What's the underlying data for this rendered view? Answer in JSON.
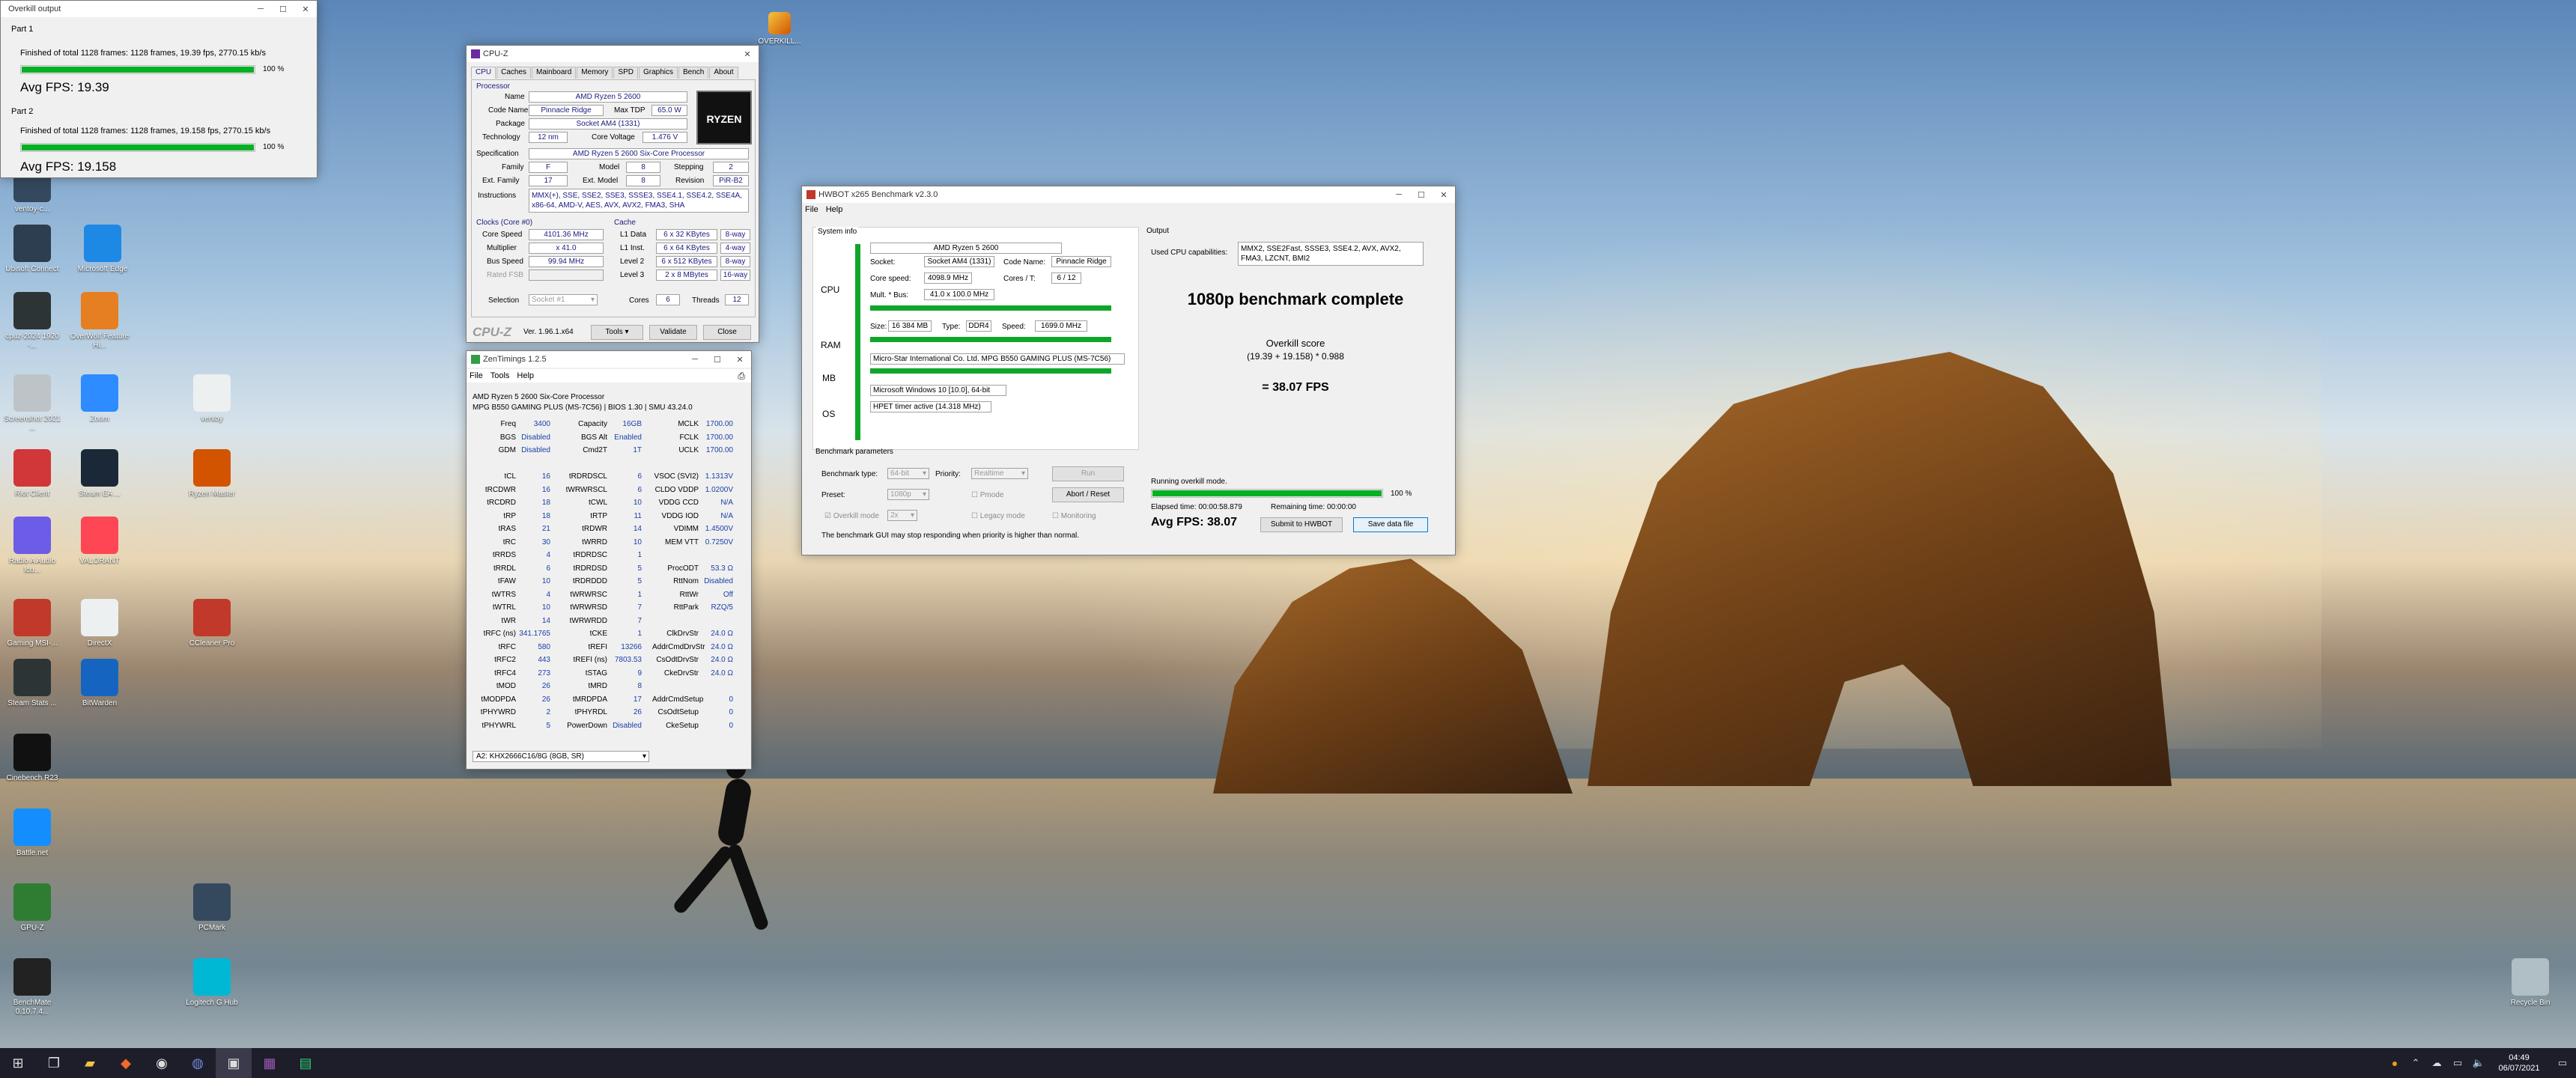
{
  "overkill": {
    "title": "Overkill output",
    "part1": "Part 1",
    "part1_line": "Finished of total 1128 frames: 1128 frames, 19.39 fps, 2770.15 kb/s",
    "part1_pct": "100 %",
    "part1_avg": "Avg FPS: 19.39",
    "part2": "Part 2",
    "part2_line": "Finished of total 1128 frames: 1128 frames, 19.158 fps, 2770.15 kb/s",
    "part2_pct": "100 %",
    "part2_avg": "Avg FPS: 19.158",
    "progress": 1.0
  },
  "cpuz": {
    "title": "CPU-Z",
    "tabs": [
      "CPU",
      "Caches",
      "Mainboard",
      "Memory",
      "SPD",
      "Graphics",
      "Bench",
      "About"
    ],
    "processor_group": "Processor",
    "name_label": "Name",
    "name": "AMD Ryzen 5 2600",
    "codename_label": "Code Name",
    "codename": "Pinnacle Ridge",
    "maxtdp_label": "Max TDP",
    "maxtdp": "65.0 W",
    "package_label": "Package",
    "package": "Socket AM4 (1331)",
    "tech_label": "Technology",
    "tech": "12 nm",
    "corev_label": "Core Voltage",
    "corev": "1.476 V",
    "spec_label": "Specification",
    "spec": "AMD Ryzen 5 2600 Six-Core Processor",
    "family_label": "Family",
    "family": "F",
    "model_label": "Model",
    "model": "8",
    "stepping_label": "Stepping",
    "stepping": "2",
    "extfam_label": "Ext. Family",
    "extfam": "17",
    "extmodel_label": "Ext. Model",
    "extmodel": "8",
    "revision_label": "Revision",
    "revision": "PiR-B2",
    "instr_label": "Instructions",
    "instr1": "MMX(+), SSE, SSE2, SSE3, SSSE3, SSE4.1, SSE4.2, SSE4A,",
    "instr2": "x86-64, AMD-V, AES, AVX, AVX2, FMA3, SHA",
    "clocks_label": "Clocks (Core #0)",
    "corespeed_label": "Core Speed",
    "corespeed": "4101.36 MHz",
    "mult_label": "Multiplier",
    "mult": "x 41.0",
    "bus_label": "Bus Speed",
    "bus": "99.94 MHz",
    "fsb_label": "Rated FSB",
    "cache_label": "Cache",
    "l1d_label": "L1 Data",
    "l1d": "6 x 32 KBytes",
    "l1d_w": "8-way",
    "l1i_label": "L1 Inst.",
    "l1i": "6 x 64 KBytes",
    "l1i_w": "4-way",
    "l2_label": "Level 2",
    "l2": "6 x 512 KBytes",
    "l2_w": "8-way",
    "l3_label": "Level 3",
    "l3": "2 x 8 MBytes",
    "l3_w": "16-way",
    "sel_label": "Selection",
    "sel": "Socket #1",
    "cores_label": "Cores",
    "cores": "6",
    "threads_label": "Threads",
    "threads": "12",
    "brand": "CPU-Z",
    "version": "Ver. 1.96.1.x64",
    "tools": "Tools",
    "validate": "Validate",
    "close": "Close",
    "logo": "RYZEN"
  },
  "zen": {
    "title": "ZenTimings 1.2.5",
    "menu": [
      "File",
      "Tools",
      "Help"
    ],
    "cpu": "AMD Ryzen 5 2600 Six-Core Processor",
    "board": "MPG B550 GAMING PLUS (MS-7C56) | BIOS 1.30 | SMU 43.24.0",
    "col1": [
      [
        "Freq",
        "3400"
      ],
      [
        "BGS",
        "Disabled"
      ],
      [
        "GDM",
        "Disabled"
      ],
      [
        "",
        ""
      ],
      [
        "tCL",
        "16"
      ],
      [
        "tRCDWR",
        "16"
      ],
      [
        "tRCDRD",
        "18"
      ],
      [
        "tRP",
        "18"
      ],
      [
        "tRAS",
        "21"
      ],
      [
        "tRC",
        "30"
      ],
      [
        "tRRDS",
        "4"
      ],
      [
        "tRRDL",
        "6"
      ],
      [
        "tFAW",
        "10"
      ],
      [
        "tWTRS",
        "4"
      ],
      [
        "tWTRL",
        "10"
      ],
      [
        "tWR",
        "14"
      ],
      [
        "tRFC (ns)",
        "341.1765"
      ],
      [
        "tRFC",
        "580"
      ],
      [
        "tRFC2",
        "443"
      ],
      [
        "tRFC4",
        "273"
      ],
      [
        "tMOD",
        "26"
      ],
      [
        "tMODPDA",
        "26"
      ],
      [
        "tPHYWRD",
        "2"
      ],
      [
        "tPHYWRL",
        "5"
      ]
    ],
    "col2": [
      [
        "Capacity",
        "16GB"
      ],
      [
        "BGS Alt",
        "Enabled"
      ],
      [
        "Cmd2T",
        "1T"
      ],
      [
        "",
        ""
      ],
      [
        "tRDRDSCL",
        "6"
      ],
      [
        "tWRWRSCL",
        "6"
      ],
      [
        "tCWL",
        "10"
      ],
      [
        "tRTP",
        "11"
      ],
      [
        "tRDWR",
        "14"
      ],
      [
        "tWRRD",
        "10"
      ],
      [
        "tRDRDSC",
        "1"
      ],
      [
        "tRDRDSD",
        "5"
      ],
      [
        "tRDRDDD",
        "5"
      ],
      [
        "tWRWRSC",
        "1"
      ],
      [
        "tWRWRSD",
        "7"
      ],
      [
        "tWRWRDD",
        "7"
      ],
      [
        "tCKE",
        "1"
      ],
      [
        "tREFI",
        "13266"
      ],
      [
        "tREFI (ns)",
        "7803.53"
      ],
      [
        "tSTAG",
        "9"
      ],
      [
        "tMRD",
        "8"
      ],
      [
        "tMRDPDA",
        "17"
      ],
      [
        "tPHYRDL",
        "26"
      ],
      [
        "PowerDown",
        "Disabled"
      ]
    ],
    "col3": [
      [
        "MCLK",
        "1700.00"
      ],
      [
        "FCLK",
        "1700.00"
      ],
      [
        "UCLK",
        "1700.00"
      ],
      [
        "",
        ""
      ],
      [
        "VSOC (SVI2)",
        "1.1313V"
      ],
      [
        "CLDO VDDP",
        "1.0200V"
      ],
      [
        "VDDG CCD",
        "N/A"
      ],
      [
        "VDDG IOD",
        "N/A"
      ],
      [
        "VDIMM",
        "1.4500V"
      ],
      [
        "MEM VTT",
        "0.7250V"
      ],
      [
        "",
        ""
      ],
      [
        "ProcODT",
        "53.3 Ω"
      ],
      [
        "RttNom",
        "Disabled"
      ],
      [
        "RttWr",
        "Off"
      ],
      [
        "RttPark",
        "RZQ/5"
      ],
      [
        "",
        ""
      ],
      [
        "ClkDrvStr",
        "24.0 Ω"
      ],
      [
        "AddrCmdDrvStr",
        "24.0 Ω"
      ],
      [
        "CsOdtDrvStr",
        "24.0 Ω"
      ],
      [
        "CkeDrvStr",
        "24.0 Ω"
      ],
      [
        "",
        ""
      ],
      [
        "AddrCmdSetup",
        "0"
      ],
      [
        "CsOdtSetup",
        "0"
      ],
      [
        "CkeSetup",
        "0"
      ]
    ],
    "dimm": "A2: KHX2666C16/8G (8GB, SR)"
  },
  "hwbot": {
    "title": "HWBOT x265 Benchmark v2.3.0",
    "menu": [
      "File",
      "Help"
    ],
    "sysinfo": "System info",
    "output": "Output",
    "cpu_tag": "CPU",
    "cpu_name": "AMD Ryzen 5 2600",
    "socket_label": "Socket:",
    "socket": "Socket AM4 (1331)",
    "codename_label": "Code Name:",
    "codename": "Pinnacle Ridge",
    "corespeed_label": "Core speed:",
    "corespeed": "4098.9 MHz",
    "coret_label": "Cores / T:",
    "coret": "6 / 12",
    "mult_label": "Mult. * Bus:",
    "mult": "41.0 x 100.0 MHz",
    "ram_tag": "RAM",
    "size_label": "Size:",
    "size": "16 384 MB",
    "type_label": "Type:",
    "type": "DDR4",
    "speed_label": "Speed:",
    "speed": "1699.0 MHz",
    "mb_tag": "MB",
    "mb": "Micro-Star International Co. Ltd. MPG B550 GAMING PLUS (MS-7C56)",
    "os_tag": "OS",
    "os": "Microsoft Windows 10 [10.0], 64-bit",
    "timer": "HPET timer active (14.318 MHz)",
    "params": "Benchmark parameters",
    "btype_label": "Benchmark type:",
    "btype": "64-bit",
    "prio_label": "Priority:",
    "prio": "Realtime",
    "run": "Run",
    "preset_label": "Preset:",
    "preset": "1080p",
    "pmode": "Pmode",
    "abort": "Abort / Reset",
    "overkill_label": "Overkill mode",
    "overkill_val": "2x",
    "legacy": "Legacy mode",
    "monitoring": "Monitoring",
    "gui_note": "The benchmark GUI may stop responding when priority is higher than normal.",
    "caps_label": "Used CPU capabilities:",
    "caps": "MMX2, SSE2Fast, SSSE3, SSE4.2, AVX, AVX2, FMA3, LZCNT, BMI2",
    "headline": "1080p benchmark complete",
    "score_label": "Overkill score",
    "score_formula": "(19.39 + 19.158) * 0.988",
    "score": "= 38.07 FPS",
    "running": "Running overkill mode.",
    "pct": "100 %",
    "elapsed": "Elapsed time: 00:00:58.879",
    "remaining": "Remaining time: 00:00:00",
    "avg": "Avg FPS: 38.07",
    "submit": "Submit to HWBOT",
    "save": "Save data file",
    "progress": 1.0
  },
  "desktop": {
    "icons": [
      "ventoy-c...",
      "Ubisoft Connect",
      "Microsoft Edge",
      "cpuz-2024 1920 -...",
      "OverWolf Feature Hi...",
      "Screenshot 2021 ...",
      "Zoom",
      "ventoy",
      "Steam EA ...",
      "Riot Client",
      "Radio A Audio Ico...",
      "VALORANT",
      "Gaming MSI-...",
      "DirectX",
      "Steam Stats ...",
      "BitWarden",
      "Cinebench R23",
      "Battle.net",
      "GPU-Z",
      "BenchMate 0.10.7.4...",
      "Ryzen Master",
      "CCleaner Pro",
      "PCMark",
      "Logitech G Hub",
      "Recycle Bin"
    ],
    "top_icon": "OVERKILL..."
  },
  "taskbar": {
    "time": "04:49",
    "date": "06/07/2021"
  },
  "colors": {
    "progress_green": "#06b025",
    "accent": "#0078d7",
    "cpuz_value": "#1a1a80"
  }
}
